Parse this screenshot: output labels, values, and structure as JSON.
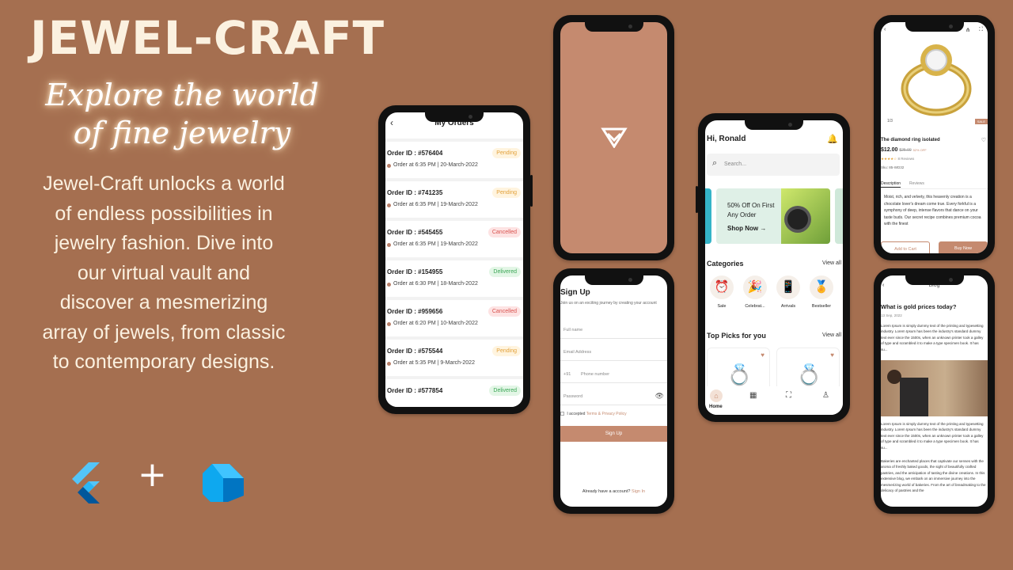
{
  "promo": {
    "title": "JEWEL-CRAFT",
    "tagline": "Explore the world of fine jewelry",
    "description": "Jewel-Craft unlocks a world of endless possibilities in jewelry fashion. Dive into our virtual vault and discover a mesmerizing array of jewels, from classic to contemporary designs.",
    "logos": {
      "flutter": "flutter-logo-icon",
      "plus": "+",
      "dart": "dart-logo-icon"
    }
  },
  "colors": {
    "background": "#a56f50",
    "accent": "#c58a6f",
    "pending": "#e2a13a",
    "cancelled": "#d9534f",
    "delivered": "#3aa655"
  },
  "orders_screen": {
    "back": "‹",
    "title": "My Orders",
    "orders": [
      {
        "id": "Order ID : #576404",
        "date": "Order at 6:35 PM | 20-March-2022",
        "status": "Pending",
        "kind": "pending"
      },
      {
        "id": "Order ID : #741235",
        "date": "Order at 6:35 PM | 19-March-2022",
        "status": "Pending",
        "kind": "pending"
      },
      {
        "id": "Order ID : #545455",
        "date": "Order at 6:35 PM | 19-March-2022",
        "status": "Cancelled",
        "kind": "cancelled"
      },
      {
        "id": "Order ID : #154955",
        "date": "Order at 6:30 PM | 18-March-2022",
        "status": "Delivered",
        "kind": "delivered"
      },
      {
        "id": "Order ID : #959656",
        "date": "Order at 6:20 PM | 10-March-2022",
        "status": "Cancelled",
        "kind": "cancelled"
      },
      {
        "id": "Order ID : #575544",
        "date": "Order at 5:35 PM | 9-March-2022",
        "status": "Pending",
        "kind": "pending"
      },
      {
        "id": "Order ID : #577854",
        "date": "",
        "status": "Delivered",
        "kind": "delivered"
      }
    ]
  },
  "splash_screen": {
    "logo": "diamond-logo-icon"
  },
  "signup_screen": {
    "title": "Sign Up",
    "subtitle": "Join us on an exciting journey by creating your account",
    "full_name_placeholder": "Full name",
    "email_placeholder": "Email Address",
    "phone_code": "+91",
    "phone_placeholder": "Phone number",
    "password_placeholder": "Password",
    "eye_icon": "👁",
    "accept_prefix": "I accepted",
    "terms_link": "Terms & Privacy Policy",
    "button": "Sign Up",
    "footer_text": "Already have a account?",
    "footer_link": "Sign In"
  },
  "home_screen": {
    "greeting": "Hi, Ronald",
    "bell": "🔔",
    "search_icon": "⌕",
    "search_placeholder": "Search...",
    "banner_text": "50% Off On First Any Order",
    "banner_cta": "Shop Now →",
    "categories_title": "Categories",
    "view_all": "View all",
    "categories": [
      {
        "label": "Sale",
        "icon": "⏰"
      },
      {
        "label": "Celebrat...",
        "icon": "🎉"
      },
      {
        "label": "Arrivals",
        "icon": "📱"
      },
      {
        "label": "Bestseller",
        "icon": "🏅"
      }
    ],
    "top_picks_title": "Top Picks for you",
    "top_picks_view_all": "View all",
    "heart": "♥",
    "ring": "💍",
    "nav": {
      "home_icon": "⌂",
      "home_label": "Home",
      "grid_icon": "▦",
      "bag_icon": "⛶",
      "user_icon": "♙"
    }
  },
  "product_screen": {
    "back": "‹",
    "share": "⋔",
    "bag": "⛶",
    "image_index": "1/3",
    "sale_badge": "SALE",
    "name": "The diamond ring isolated",
    "heart": "♡",
    "price": "$12.00",
    "old_price": "$25.00",
    "discount": "52% OFF",
    "stars": "★★★★☆",
    "reviews": "8 Reviews",
    "sku": "Sku: 85-WD32",
    "tab_description": "Description",
    "tab_reviews": "Reviews",
    "description": "Moist, rich, and velvety, this heavenly creation is a chocolate lover's dream come true. Every forkful is a symphony of deep, intense flavors that dance on your taste buds. Our secret recipe combines premium cocoa with the finest",
    "add_to_cart": "Add to Cart",
    "buy_now": "Buy Now"
  },
  "blog_screen": {
    "back": "‹",
    "title": "Blog",
    "heading": "What is gold prices today?",
    "date": "13 Sep, 2022",
    "para1": "Lorem Ipsum is simply dummy text of the printing and typesetting industry. Lorem Ipsum has been the industry's standard dummy text ever since the 1500s, when an unknown printer took a galley of type and scrambled it to make a type specimen book. It has su...",
    "para2": "Lorem Ipsum is simply dummy text of the printing and typesetting industry. Lorem Ipsum has been the industry's standard dummy text ever since the 1500s, when an unknown printer took a galley of type and scrambled it to make a type specimen book. It has su...",
    "para3": "Bakeries are enchanted places that captivate our senses with the aroma of freshly baked goods, the sight of beautifully crafted pastries, and the anticipation of tasting the divine creations. In this extensive blog, we embark on an immersive journey into the mesmerizing world of bakeries. From the art of breadmaking to the delicacy of pastries and the"
  }
}
